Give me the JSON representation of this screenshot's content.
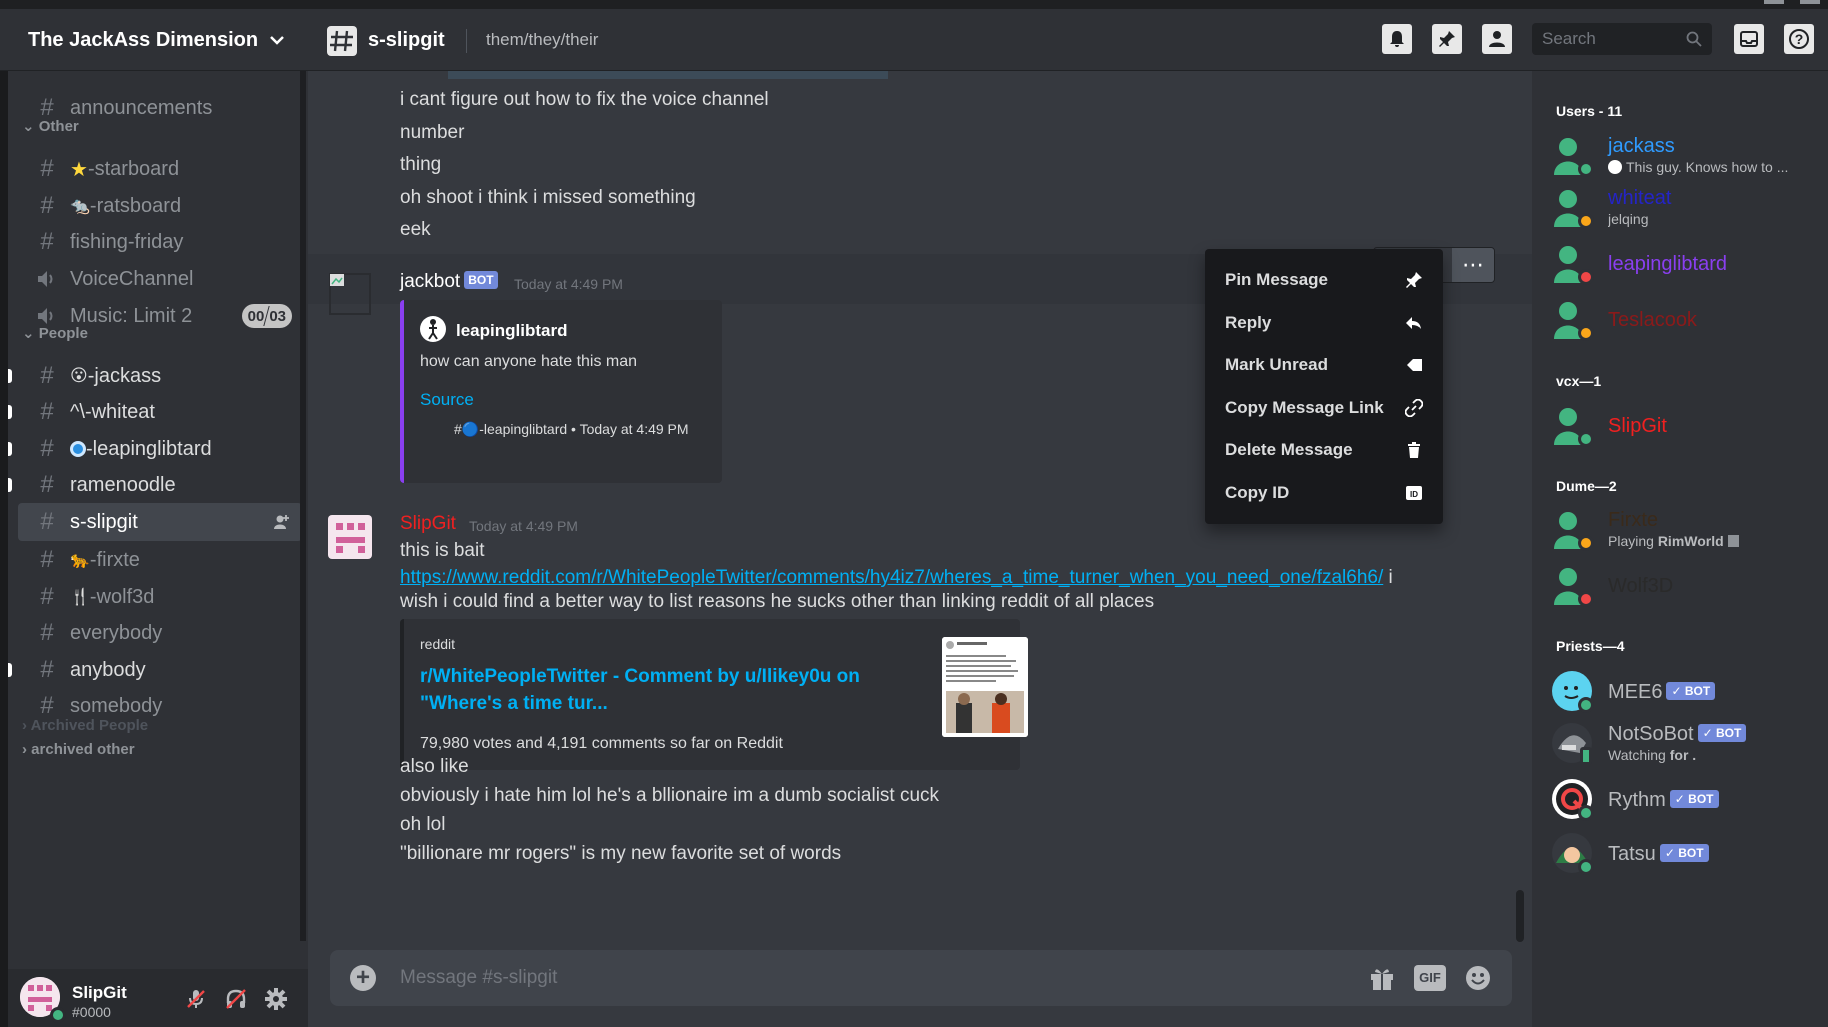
{
  "header": {
    "server_name": "The JackAss Dimension",
    "channel_name": "s-slipgit",
    "topic": "them/they/their",
    "search_placeholder": "Search"
  },
  "sidebar": {
    "channels": [
      {
        "label": "announcements",
        "icon": "hash-icon"
      },
      {
        "label": "-starboard",
        "icon": "hash-icon",
        "emoji": "★"
      },
      {
        "label": "-ratsboard",
        "icon": "hash-icon",
        "emoji": "🐀"
      },
      {
        "label": "fishing-friday",
        "icon": "hash-icon"
      },
      {
        "label": "VoiceChannel",
        "icon": "speaker-icon"
      },
      {
        "label": "Music: Limit 2",
        "icon": "speaker-icon"
      },
      {
        "label": "-jackass",
        "icon": "hash-icon",
        "emoji": "😮"
      },
      {
        "label": "-whiteat",
        "icon": "hash-icon",
        "emoji": "^\\"
      },
      {
        "label": "-leapinglibtard",
        "icon": "hash-icon",
        "emoji": "🔵"
      },
      {
        "label": "ramenoodle",
        "icon": "hash-icon"
      },
      {
        "label": "s-slipgit",
        "icon": "hash-icon"
      },
      {
        "label": "-firxte",
        "icon": "hash-icon",
        "emoji": "🐆"
      },
      {
        "label": "-wolf3d",
        "icon": "hash-icon",
        "emoji": "🍴"
      },
      {
        "label": "everybody",
        "icon": "hash-icon"
      },
      {
        "label": "anybody",
        "icon": "hash-icon"
      },
      {
        "label": "somebody",
        "icon": "hash-icon"
      }
    ],
    "categories": {
      "other": "Other",
      "people": "People",
      "archived_people": "Archived People",
      "archived_other": "archived other"
    },
    "voice_limit": {
      "current": "00",
      "max": "03"
    }
  },
  "user_panel": {
    "name": "SlipGit",
    "tag": "#0000"
  },
  "messages": {
    "continuation": [
      "i cant figure out how to fix the voice channel",
      "number",
      "thing",
      "oh shoot i think i missed something",
      "eek"
    ],
    "jackbot": {
      "author": "jackbot",
      "bot_tag": "BOT",
      "time": "Today at 4:49 PM",
      "embed": {
        "author": "leapinglibtard",
        "text": "how can anyone hate this man",
        "link": "Source",
        "footer": "#🔵-leapinglibtard • Today at 4:49 PM"
      }
    },
    "slipgit": {
      "author": "SlipGit",
      "time": "Today at 4:49 PM",
      "line1": "this is bait",
      "url": "https://www.reddit.com/r/WhitePeopleTwitter/comments/hy4iz7/wheres_a_time_turner_when_you_need_one/fzal6h6/",
      "url_after": " i",
      "line2": "wish i could find a better way to list reasons he sucks other than linking reddit of all places",
      "embed": {
        "provider": "reddit",
        "title_line1": "r/WhitePeopleTwitter - Comment by u/Ilikey0u on",
        "title_line2": "\"Where's a time tur...",
        "description": "79,980 votes and 4,191 comments so far on Reddit"
      },
      "after": [
        "also like",
        "obviously i hate him lol he's a bllionaire im a dumb socialist cuck",
        "oh lol",
        "\"billionare mr rogers\" is my new favorite set of words"
      ]
    }
  },
  "context_menu": [
    {
      "label": "Pin Message",
      "icon": "pin-icon"
    },
    {
      "label": "Reply",
      "icon": "reply-icon"
    },
    {
      "label": "Mark Unread",
      "icon": "mark-unread-icon"
    },
    {
      "label": "Copy Message Link",
      "icon": "link-icon"
    },
    {
      "label": "Delete Message",
      "icon": "trash-icon"
    },
    {
      "label": "Copy ID",
      "icon": "id-icon"
    }
  ],
  "composer": {
    "placeholder": "Message #s-slipgit"
  },
  "members": {
    "groups": [
      {
        "title": "Users - 11",
        "members": [
          {
            "name": "jackass",
            "color": "#2f9bff",
            "status": "online",
            "sub": "This guy. Knows how to ..."
          },
          {
            "name": "whiteat",
            "color": "#2424c8",
            "status": "idle",
            "sub": "jelqing"
          },
          {
            "name": "leapinglibtard",
            "color": "#8a3ff0",
            "status": "dnd",
            "sub": ""
          },
          {
            "name": "Teslacook",
            "color": "#8b1a1a",
            "status": "idle",
            "sub": ""
          }
        ]
      },
      {
        "title": "vcx—1",
        "members": [
          {
            "name": "SlipGit",
            "color": "#f02020",
            "status": "online",
            "sub": ""
          }
        ]
      },
      {
        "title": "Dume—2",
        "members": [
          {
            "name": "Firxte",
            "color": "#3a2a1a",
            "status": "idle",
            "sub_prefix": "Playing ",
            "sub_bold": "RimWorld"
          },
          {
            "name": "Wolf3D",
            "color": "#2a2a2a",
            "status": "dnd",
            "sub": ""
          }
        ]
      },
      {
        "title": "Priests—4",
        "members": [
          {
            "name": "MEE6",
            "color": "#b9bbbe",
            "status": "online",
            "bot": "✓ BOT"
          },
          {
            "name": "NotSoBot",
            "color": "#b9bbbe",
            "status": "mobile",
            "bot": "✓ BOT",
            "sub_prefix": "Watching ",
            "sub_bold": "for ."
          },
          {
            "name": "Rythm",
            "color": "#b9bbbe",
            "status": "online",
            "bot": "✓ BOT"
          },
          {
            "name": "Tatsu",
            "color": "#b9bbbe",
            "status": "online",
            "bot": "✓ BOT"
          }
        ]
      }
    ]
  },
  "colors": {
    "accent_link": "#00b0f4",
    "bot_badge": "#7289da",
    "slipgit_red": "#f02020",
    "embed_bar": "#8a3ff0"
  }
}
